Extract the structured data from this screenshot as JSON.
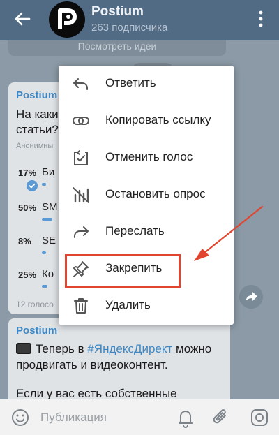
{
  "header": {
    "title": "Postium",
    "subtitle": "263 подписчика"
  },
  "chat": {
    "prev_button": "Посмотреть идеи",
    "poll_message": {
      "author": "Postium",
      "question": "На каки статьи?",
      "poll_type": "Анонимны",
      "options": [
        {
          "percent": "17%",
          "label": "Би",
          "value": 17,
          "voted": true
        },
        {
          "percent": "50%",
          "label": "SM",
          "value": 50,
          "voted": false
        },
        {
          "percent": "8%",
          "label": "SE",
          "value": 8,
          "voted": false
        },
        {
          "percent": "25%",
          "label": "Ко",
          "value": 25,
          "voted": false
        }
      ],
      "votes": "12 голосо"
    },
    "post_message": {
      "author": "Postium",
      "line1_pre": "Теперь в ",
      "line1_tag": "#ЯндексДирект",
      "line1_post": " можно",
      "line2": "продвигать и видеоконтент.",
      "line3": "Если у вас есть собственные"
    }
  },
  "context_menu": {
    "items": [
      {
        "label": "Ответить",
        "icon": "reply-icon"
      },
      {
        "label": "Копировать ссылку",
        "icon": "link-icon"
      },
      {
        "label": "Отменить голос",
        "icon": "retract-vote-icon"
      },
      {
        "label": "Остановить опрос",
        "icon": "stop-poll-icon"
      },
      {
        "label": "Переслать",
        "icon": "forward-icon"
      },
      {
        "label": "Закрепить",
        "icon": "pin-icon"
      },
      {
        "label": "Удалить",
        "icon": "trash-icon"
      }
    ],
    "highlighted_item": "Закрепить",
    "highlight_color": "#e2452f"
  },
  "input_bar": {
    "placeholder": "Публикация"
  },
  "colors": {
    "header_bg": "#526b85",
    "chat_bg": "#8b9aa6",
    "accent": "#3f87c2"
  }
}
